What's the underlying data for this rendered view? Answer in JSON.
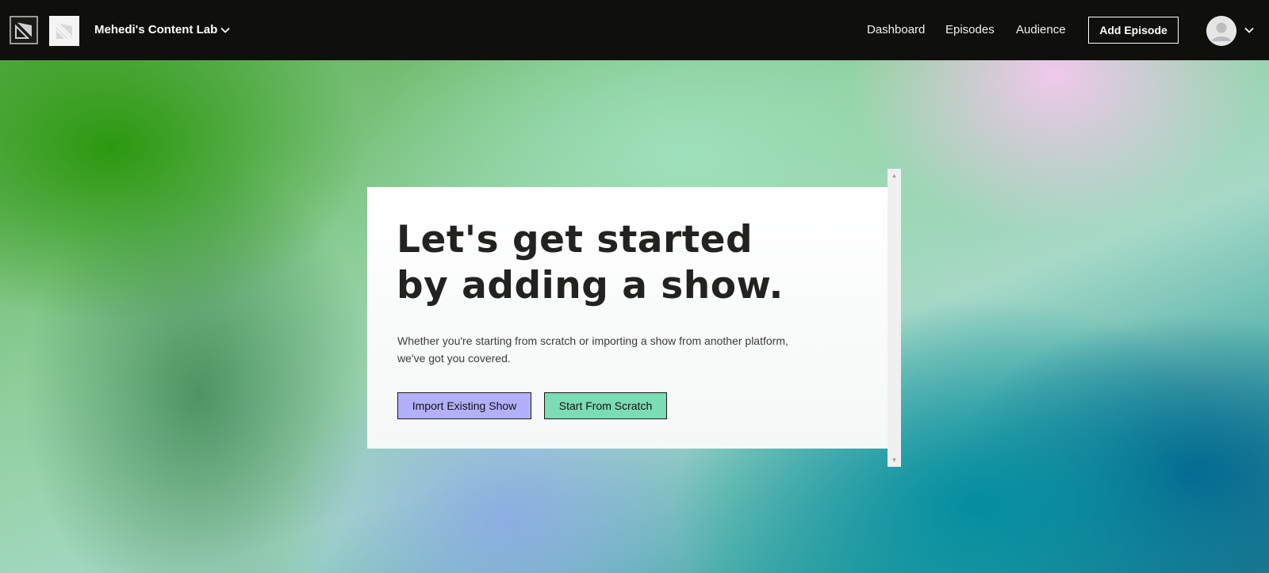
{
  "header": {
    "workspace_name": "Mehedi's Content Lab",
    "nav": {
      "dashboard": "Dashboard",
      "episodes": "Episodes",
      "audience": "Audience"
    },
    "add_episode_label": "Add Episode",
    "icons": {
      "brand_logo": "brand-logo-icon",
      "show_logo": "show-logo-icon",
      "workspace_dropdown": "chevron-down-icon",
      "avatar": "user-avatar-icon",
      "account_dropdown": "chevron-down-icon"
    }
  },
  "onboarding": {
    "headline_line1": "Let's get started",
    "headline_line2": "by adding a show.",
    "subtext_line1": "Whether you're starting from scratch or importing a show from another platform,",
    "subtext_line2": "we've got you covered.",
    "import_button_label": "Import Existing Show",
    "scratch_button_label": "Start From Scratch"
  },
  "colors": {
    "topbar_bg": "#0f0f0b",
    "import_button_bg": "#b3b0fa",
    "scratch_button_bg": "#7cdcb4",
    "headline_color": "#222220"
  }
}
